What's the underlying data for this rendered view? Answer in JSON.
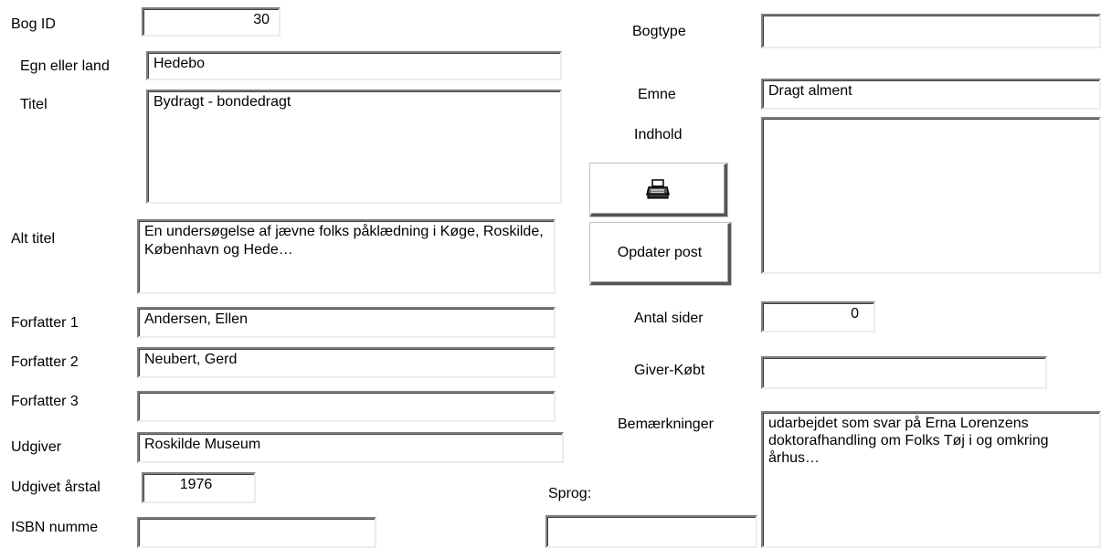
{
  "labels": {
    "bog_id": "Bog ID",
    "egn": "Egn eller land",
    "titel": "Titel",
    "alt_titel": "Alt titel",
    "forfatter1": "Forfatter 1",
    "forfatter2": "Forfatter 2",
    "forfatter3": "Forfatter 3",
    "udgiver": "Udgiver",
    "udgivet_aarstal": "Udgivet årstal",
    "isbn": "ISBN numme",
    "bogtype": "Bogtype",
    "emne": "Emne",
    "indhold": "Indhold",
    "antal_sider": "Antal sider",
    "giver": "Giver-Købt",
    "bemaerkninger": "Bemærkninger",
    "sprog": "Sprog:"
  },
  "values": {
    "bog_id": "30",
    "egn": "Hedebo",
    "titel": "Bydragt - bondedragt",
    "alt_titel": "En undersøgelse af jævne folks påklædning i Køge, Roskilde, København og Hede…",
    "forfatter1": "Andersen, Ellen",
    "forfatter2": "Neubert, Gerd",
    "forfatter3": "",
    "udgiver": "Roskilde Museum",
    "udgivet_aarstal": "1976",
    "isbn": "",
    "bogtype": "",
    "emne": "Dragt alment",
    "indhold": "",
    "antal_sider": "0",
    "giver": "",
    "bemaerkninger": "udarbejdet som svar på Erna Lorenzens doktorafhandling om Folks Tøj i og omkring århus…",
    "sprog": ""
  },
  "buttons": {
    "print_icon": "printer-icon",
    "opdater": "Opdater post"
  }
}
